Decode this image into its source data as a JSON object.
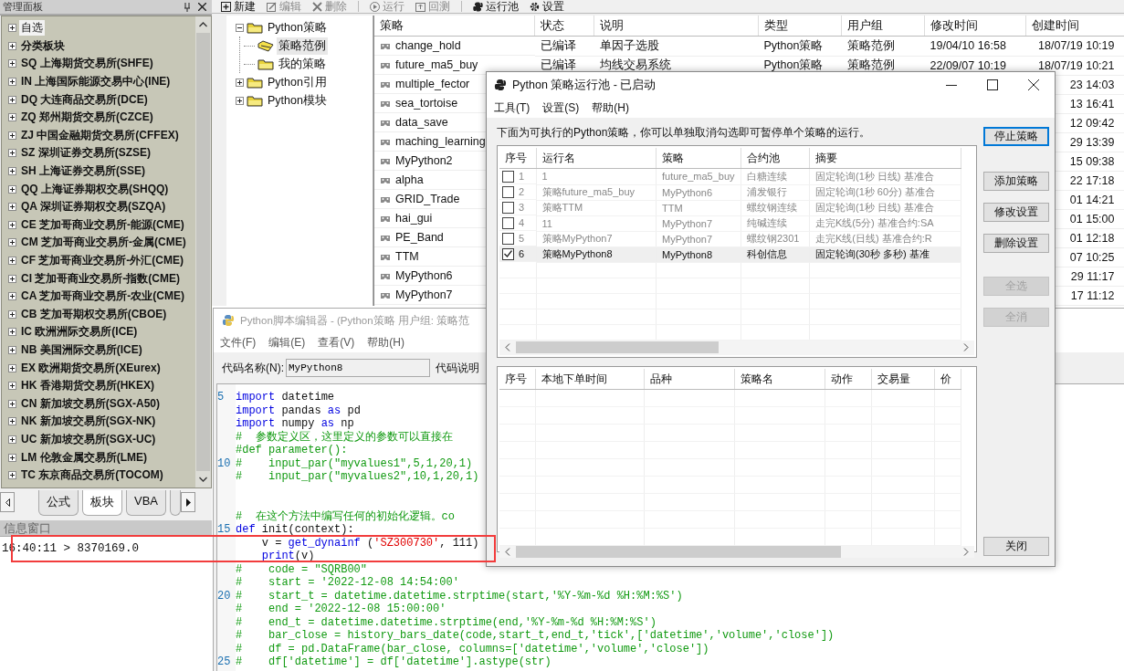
{
  "left_panel": {
    "title": "管理面板",
    "tree": [
      {
        "label": "自选",
        "selected": true,
        "expanded": false
      },
      {
        "label": "分类板块",
        "selected": false,
        "expanded": false
      },
      {
        "label": "SQ 上海期货交易所(SHFE)",
        "selected": false,
        "expanded": false
      },
      {
        "label": "IN 上海国际能源交易中心(INE)",
        "selected": false,
        "expanded": false
      },
      {
        "label": "DQ 大连商品交易所(DCE)",
        "selected": false,
        "expanded": false
      },
      {
        "label": "ZQ 郑州期货交易所(CZCE)",
        "selected": false,
        "expanded": false
      },
      {
        "label": "ZJ 中国金融期货交易所(CFFEX)",
        "selected": false,
        "expanded": false
      },
      {
        "label": "SZ 深圳证券交易所(SZSE)",
        "selected": false,
        "expanded": false
      },
      {
        "label": "SH 上海证券交易所(SSE)",
        "selected": false,
        "expanded": false
      },
      {
        "label": "QQ 上海证券期权交易(SHQQ)",
        "selected": false,
        "expanded": false
      },
      {
        "label": "QA 深圳证券期权交易(SZQA)",
        "selected": false,
        "expanded": false
      },
      {
        "label": "CE 芝加哥商业交易所-能源(CME)",
        "selected": false,
        "expanded": false
      },
      {
        "label": "CM 芝加哥商业交易所-金属(CME)",
        "selected": false,
        "expanded": false
      },
      {
        "label": "CF 芝加哥商业交易所-外汇(CME)",
        "selected": false,
        "expanded": false
      },
      {
        "label": "CI 芝加哥商业交易所-指数(CME)",
        "selected": false,
        "expanded": false
      },
      {
        "label": "CA 芝加哥商业交易所-农业(CME)",
        "selected": false,
        "expanded": false
      },
      {
        "label": "CB 芝加哥期权交易所(CBOE)",
        "selected": false,
        "expanded": false
      },
      {
        "label": "IC 欧洲洲际交易所(ICE)",
        "selected": false,
        "expanded": false
      },
      {
        "label": "NB 美国洲际交易所(ICE)",
        "selected": false,
        "expanded": false
      },
      {
        "label": "EX 欧洲期货交易所(XEurex)",
        "selected": false,
        "expanded": false
      },
      {
        "label": "HK 香港期货交易所(HKEX)",
        "selected": false,
        "expanded": false
      },
      {
        "label": "CN 新加坡交易所(SGX-A50)",
        "selected": false,
        "expanded": false
      },
      {
        "label": "NK 新加坡交易所(SGX-NK)",
        "selected": false,
        "expanded": false
      },
      {
        "label": "UC 新加坡交易所(SGX-UC)",
        "selected": false,
        "expanded": false
      },
      {
        "label": "LM 伦敦金属交易所(LME)",
        "selected": false,
        "expanded": false
      },
      {
        "label": "TC 东京商品交易所(TOCOM)",
        "selected": false,
        "expanded": false
      }
    ],
    "tabs": [
      {
        "kind": "tab",
        "label": "公式",
        "selected": false
      },
      {
        "kind": "tab",
        "label": "板块",
        "selected": true
      },
      {
        "kind": "tab",
        "label": "VBA",
        "selected": false
      },
      {
        "kind": "clipped",
        "selected": false
      }
    ]
  },
  "info_window": {
    "title": "信息窗口",
    "lines": [
      "16:40:11 > 8370169.0"
    ]
  },
  "toolbar": [
    {
      "kind": "new",
      "label": "新建",
      "disabled": false
    },
    {
      "kind": "edit",
      "label": "编辑",
      "disabled": true
    },
    {
      "kind": "delete",
      "label": "删除",
      "disabled": true
    },
    {
      "kind": "run",
      "label": "运行",
      "disabled": true
    },
    {
      "kind": "backtest",
      "label": "回测",
      "disabled": true
    },
    {
      "kind": "pool",
      "label": "运行池",
      "disabled": false
    },
    {
      "kind": "settings",
      "label": "设置",
      "disabled": false
    }
  ],
  "strategy_tree": [
    {
      "label": "Python策略",
      "expanded": true,
      "selected": false,
      "children": [
        {
          "label": "策略范例",
          "selected": true
        },
        {
          "label": "我的策略",
          "selected": false
        }
      ]
    },
    {
      "label": "Python引用",
      "expanded": false,
      "selected": false
    },
    {
      "label": "Python模块",
      "expanded": false,
      "selected": false
    }
  ],
  "strategy_table": {
    "columns": [
      "策略",
      "状态",
      "说明",
      "类型",
      "用户组",
      "修改时间",
      "创建时间"
    ],
    "rows": [
      {
        "name": "change_hold",
        "status": "已编译",
        "description": "单因子选股",
        "type": "Python策略",
        "group": "策略范例",
        "modified": "19/04/10 16:58",
        "created": "18/07/19 10:19"
      },
      {
        "name": "future_ma5_buy",
        "status": "已编译",
        "description": "均线交易系统",
        "type": "Python策略",
        "group": "策略范例",
        "modified": "22/09/07 10:19",
        "created": "18/07/19 10:21"
      },
      {
        "name": "multiple_fector",
        "created": "23 14:03"
      },
      {
        "name": "sea_tortoise",
        "created": "13 16:41"
      },
      {
        "name": "data_save",
        "created": "12 09:42"
      },
      {
        "name": "maching_learning",
        "created": "29 13:39"
      },
      {
        "name": "MyPython2",
        "created": "15 09:38"
      },
      {
        "name": "alpha",
        "created": "22 17:18"
      },
      {
        "name": "GRID_Trade",
        "created": "01 14:21"
      },
      {
        "name": "hai_gui",
        "created": "01 15:00"
      },
      {
        "name": "PE_Band",
        "created": "01 12:18"
      },
      {
        "name": "TTM",
        "created": "07 10:25"
      },
      {
        "name": "MyPython6",
        "created": "29 11:17"
      },
      {
        "name": "MyPython7",
        "created": "17 11:12"
      }
    ]
  },
  "editor": {
    "title": "Python脚本编辑器 - (Python策略 用户组: 策略范",
    "menu": [
      "文件(F)",
      "编辑(E)",
      "查看(V)",
      "帮助(H)"
    ],
    "name_label": "代码名称(N):",
    "name_value": "MyPython8",
    "description_label": "代码说明",
    "lines": [
      {
        "kind": "code",
        "number": "5",
        "segments": [
          {
            "kind": "keyword",
            "text": "import"
          },
          {
            "kind": "plain",
            "text": " datetime"
          }
        ]
      },
      {
        "kind": "code",
        "segments": [
          {
            "kind": "keyword",
            "text": "import"
          },
          {
            "kind": "plain",
            "text": " pandas "
          },
          {
            "kind": "keyword",
            "text": "as"
          },
          {
            "kind": "plain",
            "text": " pd"
          }
        ]
      },
      {
        "kind": "code",
        "segments": [
          {
            "kind": "keyword",
            "text": "import"
          },
          {
            "kind": "plain",
            "text": " numpy "
          },
          {
            "kind": "keyword",
            "text": "as"
          },
          {
            "kind": "plain",
            "text": " np"
          }
        ]
      },
      {
        "kind": "code",
        "segments": [
          {
            "kind": "comment",
            "text": "#  参数定义区，这里定义的参数可以直接在"
          }
        ]
      },
      {
        "kind": "code",
        "segments": [
          {
            "kind": "comment",
            "text": "#def parameter():"
          }
        ]
      },
      {
        "kind": "code",
        "number": "10",
        "segments": [
          {
            "kind": "comment",
            "text": "#    input_par(\"myvalues1\",5,1,20,1)"
          }
        ]
      },
      {
        "kind": "code",
        "segments": [
          {
            "kind": "comment",
            "text": "#    input_par(\"myvalues2\",10,1,20,1)"
          }
        ]
      },
      {
        "kind": "blank"
      },
      {
        "kind": "blank"
      },
      {
        "kind": "code",
        "segments": [
          {
            "kind": "comment",
            "text": "#  在这个方法中编写任何的初始化逻辑。co"
          }
        ]
      },
      {
        "kind": "code",
        "number": "15",
        "segments": [
          {
            "kind": "keyword",
            "text": "def"
          },
          {
            "kind": "plain",
            "text": " init(context):"
          }
        ]
      },
      {
        "kind": "code",
        "segments": [
          {
            "kind": "plain",
            "text": "    v = "
          },
          {
            "kind": "keyword",
            "text": "get_dynainf"
          },
          {
            "kind": "plain",
            "text": " ("
          },
          {
            "kind": "string",
            "text": "'SZ300730'"
          },
          {
            "kind": "plain",
            "text": ", 111)"
          }
        ]
      },
      {
        "kind": "code",
        "segments": [
          {
            "kind": "keyword",
            "text": "    print"
          },
          {
            "kind": "plain",
            "text": "(v)"
          }
        ]
      },
      {
        "kind": "code",
        "segments": [
          {
            "kind": "comment",
            "text": "#    code = \"SQRB00\""
          }
        ]
      },
      {
        "kind": "code",
        "segments": [
          {
            "kind": "comment",
            "text": "#    start = '2022-12-08 14:54:00'"
          }
        ]
      },
      {
        "kind": "code",
        "number": "20",
        "segments": [
          {
            "kind": "comment",
            "text": "#    start_t = datetime.datetime.strptime(start,'%Y-%m-%d %H:%M:%S')"
          }
        ]
      },
      {
        "kind": "code",
        "segments": [
          {
            "kind": "comment",
            "text": "#    end = '2022-12-08 15:00:00'"
          }
        ]
      },
      {
        "kind": "code",
        "segments": [
          {
            "kind": "comment",
            "text": "#    end_t = datetime.datetime.strptime(end,'%Y-%m-%d %H:%M:%S')"
          }
        ]
      },
      {
        "kind": "code",
        "segments": [
          {
            "kind": "comment",
            "text": "#    bar_close = history_bars_date(code,start_t,end_t,'tick',['datetime','volume','close'])"
          }
        ]
      },
      {
        "kind": "code",
        "segments": [
          {
            "kind": "comment",
            "text": "#    df = pd.DataFrame(bar_close, columns=['datetime','volume','close'])"
          }
        ]
      },
      {
        "kind": "code",
        "number": "25",
        "segments": [
          {
            "kind": "comment",
            "text": "#    df['datetime'] = df['datetime'].astype(str)"
          }
        ]
      }
    ]
  },
  "dialog": {
    "title": "Python 策略运行池 - 已启动",
    "menu": [
      "工具(T)",
      "设置(S)",
      "帮助(H)"
    ],
    "instruction": "下面为可执行的Python策略，你可以单独取消勾选即可暂停单个策略的运行。",
    "run_table": {
      "columns": [
        "序号",
        "运行名",
        "策略",
        "合约池",
        "摘要"
      ],
      "rows": [
        {
          "checked": false,
          "selected": false,
          "number": "1",
          "run_name": "1",
          "strategy": "future_ma5_buy",
          "pool": "白糖连续",
          "summary": "固定轮询(1秒 日线) 基准合"
        },
        {
          "checked": false,
          "selected": false,
          "number": "2",
          "run_name": "策略future_ma5_buy",
          "strategy": "MyPython6",
          "pool": "浦发银行",
          "summary": "固定轮询(1秒 60分) 基准合"
        },
        {
          "checked": false,
          "selected": false,
          "number": "3",
          "run_name": "策略TTM",
          "strategy": "TTM",
          "pool": "螺纹钢连续",
          "summary": "固定轮询(1秒 日线) 基准合"
        },
        {
          "checked": false,
          "selected": false,
          "number": "4",
          "run_name": "11",
          "strategy": "MyPython7",
          "pool": "纯碱连续",
          "summary": "走完K线(5分) 基准合约:SA"
        },
        {
          "checked": false,
          "selected": false,
          "number": "5",
          "run_name": "策略MyPython7",
          "strategy": "MyPython7",
          "pool": "螺纹钢2301",
          "summary": "走完K线(日线) 基准合约:R"
        },
        {
          "checked": true,
          "selected": true,
          "number": "6",
          "run_name": "策略MyPython8",
          "strategy": "MyPython8",
          "pool": "科创信息",
          "summary": "固定轮询(30秒 多秒) 基准"
        }
      ]
    },
    "button_groups": [
      [
        {
          "kind": "default",
          "label": "停止策略",
          "disabled": false
        }
      ],
      [
        {
          "kind": "normal",
          "label": "添加策略",
          "disabled": false
        },
        {
          "kind": "normal",
          "label": "修改设置",
          "disabled": false
        },
        {
          "kind": "normal",
          "label": "删除设置",
          "disabled": false
        }
      ],
      [
        {
          "kind": "normal",
          "label": "全选",
          "disabled": true
        },
        {
          "kind": "normal",
          "label": "全消",
          "disabled": true
        }
      ]
    ],
    "order_table": {
      "columns": [
        "序号",
        "本地下单时间",
        "品种",
        "策略名",
        "动作",
        "交易量",
        "价"
      ]
    },
    "close_button": "关闭"
  },
  "annotations": [
    {
      "kind": "rectangle"
    }
  ]
}
